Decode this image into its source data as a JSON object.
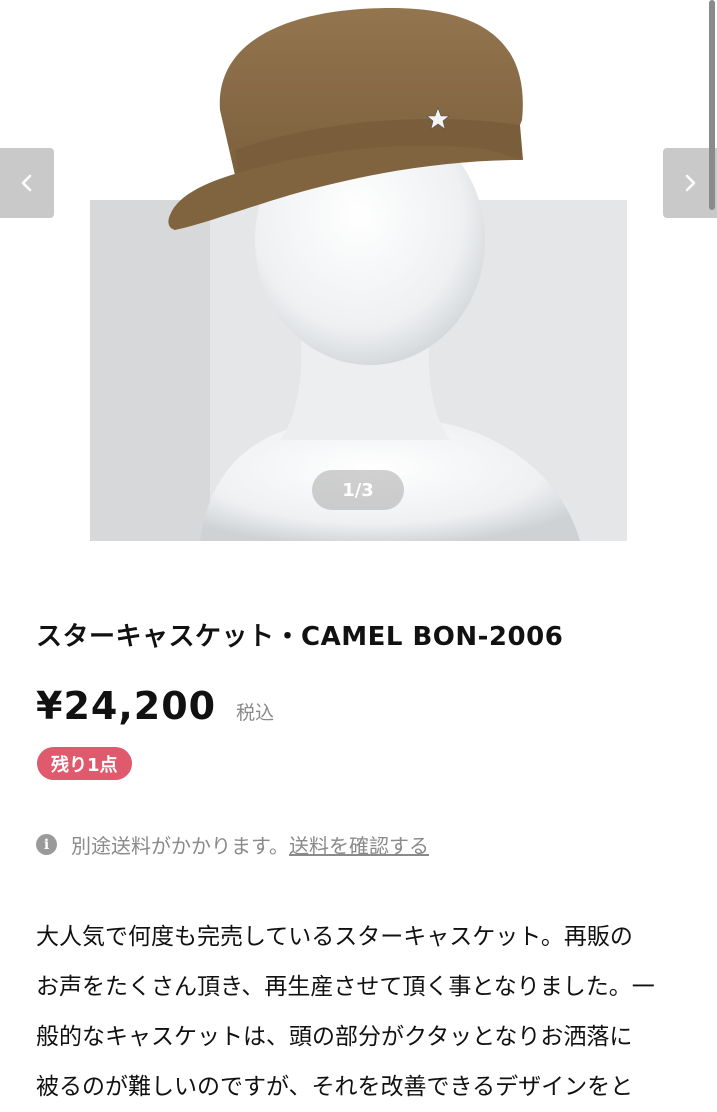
{
  "gallery": {
    "counter": "1/3",
    "prev_icon": "chevron-left-icon",
    "next_icon": "chevron-right-icon"
  },
  "product": {
    "title": "スターキャスケット・CAMEL BON-2006",
    "price": "¥24,200",
    "tax_label": "税込",
    "stock_badge": "残り1点"
  },
  "shipping": {
    "icon": "info-icon",
    "icon_glyph": "i",
    "text": "別途送料がかかります。",
    "link": "送料を確認する"
  },
  "description": {
    "lines": [
      "大人気で何度も完売しているスターキャスケット。再販の",
      "お声をたくさん頂き、再生産させて頂く事となりました。一",
      "般的なキャスケットは、頭の部分がクタッとなりお洒落に",
      "被るのが難しいのですが、それを改善できるデザインをと"
    ]
  },
  "colors": {
    "badge": "#e05a6d",
    "hat": "#8a6c47",
    "muted_text": "#8a8a8a"
  }
}
